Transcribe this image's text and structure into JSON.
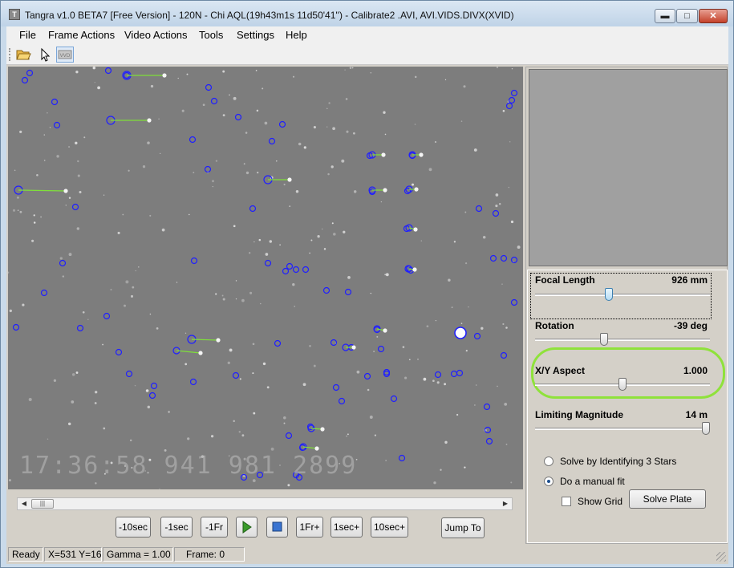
{
  "window": {
    "title": "Tangra v1.0 BETA7 [Free Version] - 120N - Chi AQL(19h43m1s 11d50'41'') - Calibrate2 .AVI, AVI.VIDS.DIVX(XVID)",
    "icon_name": "tangra-app-icon",
    "min_icon": "minimize-icon",
    "max_icon": "maximize-icon",
    "close_icon": "close-icon"
  },
  "menu": {
    "file": "File",
    "frame_actions": "Frame Actions",
    "video_actions": "Video Actions",
    "tools": "Tools",
    "settings": "Settings",
    "help": "Help"
  },
  "toolbar": {
    "open_icon": "folder-open-icon",
    "pointer_icon": "arrow-pointer-icon",
    "video_icon": "video-mode-icon"
  },
  "video": {
    "timestamp": "17:36:58  941  981  2899"
  },
  "playback": {
    "minus_10sec": "-10sec",
    "minus_1sec": "-1sec",
    "minus_1fr": "-1Fr",
    "play_icon": "play-icon",
    "stop_icon": "stop-icon",
    "plus_1fr": "1Fr+",
    "plus_1sec": "1sec+",
    "plus_10sec": "10sec+",
    "jump_to": "Jump To"
  },
  "calibration": {
    "focal_length": {
      "label": "Focal Length",
      "value": "926 mm",
      "level": 0.42
    },
    "rotation": {
      "label": "Rotation",
      "value": "-39 deg",
      "level": 0.39
    },
    "xy_aspect": {
      "label": "X/Y Aspect",
      "value": "1.000",
      "level": 0.5
    },
    "limiting_magnitude": {
      "label": "Limiting Magnitude",
      "value": "14 m",
      "level": 1.0
    },
    "options": {
      "solve_identifying": "Solve by Identifying 3 Stars",
      "manual_fit": "Do a manual fit",
      "selected": "manual_fit",
      "show_grid": "Show Grid",
      "show_grid_checked": false
    },
    "solve_plate": "Solve Plate"
  },
  "status": {
    "state": "Ready",
    "coords": "X=531 Y=16",
    "gamma": "Gamma = 1.00",
    "frame": "Frame: 0"
  },
  "colors": {
    "star_marker": "#2020ff",
    "match_line": "#7fe03a",
    "highlight": "#8fe23b"
  }
}
